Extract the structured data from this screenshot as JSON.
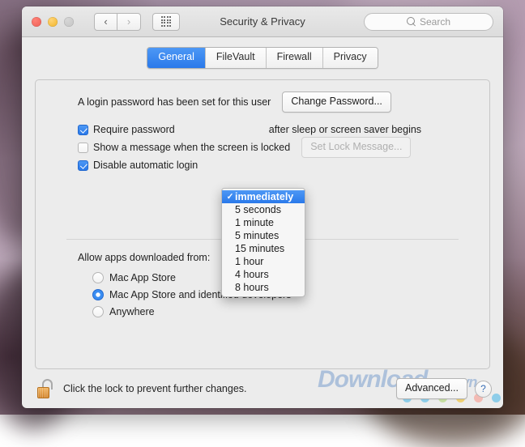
{
  "window": {
    "title": "Security & Privacy",
    "traffic_lights": [
      "close",
      "minimize",
      "zoom"
    ],
    "nav_back": "‹",
    "nav_forward": "›",
    "show_all": "show-all-grid"
  },
  "search": {
    "placeholder": "Search",
    "icon": "search-icon"
  },
  "tabs": [
    {
      "label": "General",
      "active": true
    },
    {
      "label": "FileVault",
      "active": false
    },
    {
      "label": "Firewall",
      "active": false
    },
    {
      "label": "Privacy",
      "active": false
    }
  ],
  "general": {
    "password_status": "A login password has been set for this user",
    "change_password_button": "Change Password...",
    "options": [
      {
        "label": "Require password",
        "checked": true,
        "suffix": "after sleep or screen saver begins"
      },
      {
        "label": "Show a message when the screen is locked",
        "checked": false
      },
      {
        "label": "Disable automatic login",
        "checked": true
      }
    ],
    "set_lock_message_button": "Set Lock Message...",
    "set_lock_message_disabled": true,
    "require_password_delay": {
      "selected": "immediately",
      "options": [
        "immediately",
        "5 seconds",
        "1 minute",
        "5 minutes",
        "15 minutes",
        "1 hour",
        "4 hours",
        "8 hours"
      ],
      "checkmark": "✓"
    },
    "allow_apps_title": "Allow apps downloaded from:",
    "allow_apps_options": [
      {
        "label": "Mac App Store",
        "selected": false
      },
      {
        "label": "Mac App Store and identified developers",
        "selected": true
      },
      {
        "label": "Anywhere",
        "selected": false
      }
    ]
  },
  "footer": {
    "lock_icon": "unlocked-padlock-icon",
    "lock_text": "Click the lock to prevent further changes.",
    "advanced_button": "Advanced...",
    "help_button": "?"
  },
  "watermark": {
    "text_main": "Down",
    "text_rest": "load",
    "text_suffix": ".com.vn",
    "dot_colors": [
      "#6fc3e8",
      "#6fc3e8",
      "#b9d98a",
      "#f0c84a",
      "#f6a9a0",
      "#6fc3e8"
    ]
  },
  "colors": {
    "accent_blue": "#2a79ea",
    "window_bg": "#ececec",
    "watermark_blue": "#5686c4"
  }
}
